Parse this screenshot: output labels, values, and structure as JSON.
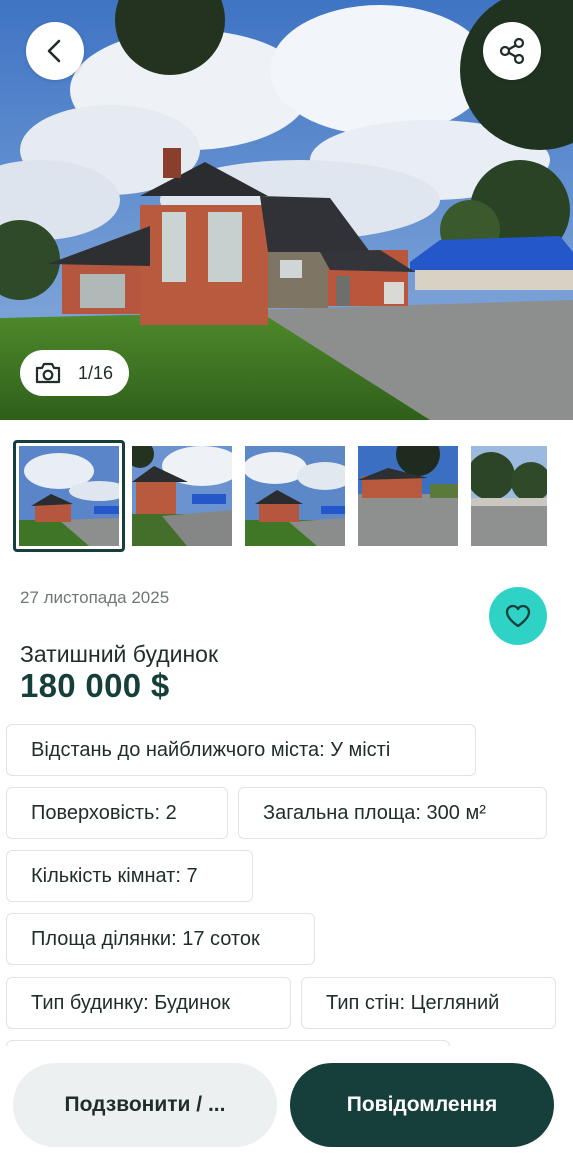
{
  "gallery": {
    "counter_text": "1/16",
    "thumbnail_count": 5,
    "selected_index": 0
  },
  "listing": {
    "date": "27 листопада 2025",
    "title": "Затишний будинок",
    "price": "180 000 $",
    "features": [
      "Відстань до найближчого міста: У місті",
      "Поверховість: 2",
      "Загальна площа: 300 м²",
      "Кількість кімнат: 7",
      "Площа ділянки: 17 соток",
      "Тип будинку: Будинок",
      "Тип стін: Цегляний"
    ]
  },
  "actions": {
    "call_label": "Подзвонити / ...",
    "message_label": "Повідомлення"
  },
  "icons": {
    "back": "chevron-left-icon",
    "share": "share-icon",
    "camera": "camera-icon",
    "favorite": "heart-icon"
  },
  "colors": {
    "primary_dark": "#163f3b",
    "accent_teal": "#2ed3c6",
    "secondary_button_bg": "#edf0f0"
  }
}
